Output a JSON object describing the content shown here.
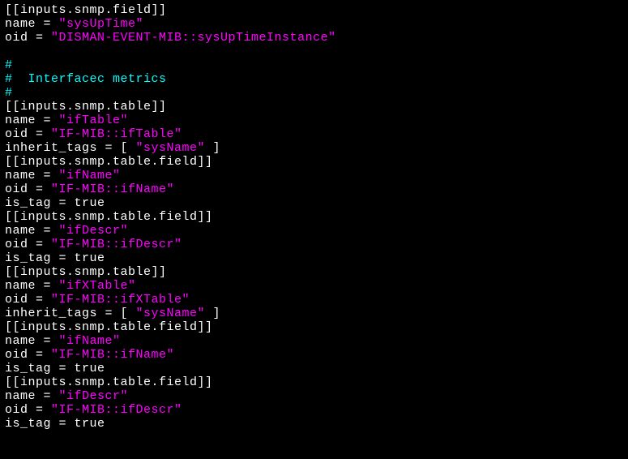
{
  "lines": [
    {
      "segments": [
        {
          "cls": "w",
          "text": "[[inputs.snmp.field]]"
        }
      ]
    },
    {
      "segments": [
        {
          "cls": "w",
          "text": "name = "
        },
        {
          "cls": "m",
          "text": "\"sysUpTime\""
        }
      ]
    },
    {
      "segments": [
        {
          "cls": "w",
          "text": "oid = "
        },
        {
          "cls": "m",
          "text": "\"DISMAN-EVENT-MIB::sysUpTimeInstance\""
        }
      ]
    },
    {
      "segments": [
        {
          "cls": "w",
          "text": ""
        }
      ]
    },
    {
      "segments": [
        {
          "cls": "c",
          "text": "#"
        }
      ]
    },
    {
      "segments": [
        {
          "cls": "c",
          "text": "#  Interfacec metrics"
        }
      ]
    },
    {
      "segments": [
        {
          "cls": "c",
          "text": "#"
        }
      ]
    },
    {
      "segments": [
        {
          "cls": "w",
          "text": "[[inputs.snmp.table]]"
        }
      ]
    },
    {
      "segments": [
        {
          "cls": "w",
          "text": "name = "
        },
        {
          "cls": "m",
          "text": "\"ifTable\""
        }
      ]
    },
    {
      "segments": [
        {
          "cls": "w",
          "text": "oid = "
        },
        {
          "cls": "m",
          "text": "\"IF-MIB::ifTable\""
        }
      ]
    },
    {
      "segments": [
        {
          "cls": "w",
          "text": "inherit_tags = [ "
        },
        {
          "cls": "m",
          "text": "\"sysName\""
        },
        {
          "cls": "w",
          "text": " ]"
        }
      ]
    },
    {
      "segments": [
        {
          "cls": "w",
          "text": "[[inputs.snmp.table.field]]"
        }
      ]
    },
    {
      "segments": [
        {
          "cls": "w",
          "text": "name = "
        },
        {
          "cls": "m",
          "text": "\"ifName\""
        }
      ]
    },
    {
      "segments": [
        {
          "cls": "w",
          "text": "oid = "
        },
        {
          "cls": "m",
          "text": "\"IF-MIB::ifName\""
        }
      ]
    },
    {
      "segments": [
        {
          "cls": "w",
          "text": "is_tag = true"
        }
      ]
    },
    {
      "segments": [
        {
          "cls": "w",
          "text": "[[inputs.snmp.table.field]]"
        }
      ]
    },
    {
      "segments": [
        {
          "cls": "w",
          "text": "name = "
        },
        {
          "cls": "m",
          "text": "\"ifDescr\""
        }
      ]
    },
    {
      "segments": [
        {
          "cls": "w",
          "text": "oid = "
        },
        {
          "cls": "m",
          "text": "\"IF-MIB::ifDescr\""
        }
      ]
    },
    {
      "segments": [
        {
          "cls": "w",
          "text": "is_tag = true"
        }
      ]
    },
    {
      "segments": [
        {
          "cls": "w",
          "text": "[[inputs.snmp.table]]"
        }
      ]
    },
    {
      "segments": [
        {
          "cls": "w",
          "text": "name = "
        },
        {
          "cls": "m",
          "text": "\"ifXTable\""
        }
      ]
    },
    {
      "segments": [
        {
          "cls": "w",
          "text": "oid = "
        },
        {
          "cls": "m",
          "text": "\"IF-MIB::ifXTable\""
        }
      ]
    },
    {
      "segments": [
        {
          "cls": "w",
          "text": "inherit_tags = [ "
        },
        {
          "cls": "m",
          "text": "\"sysName\""
        },
        {
          "cls": "w",
          "text": " ]"
        }
      ]
    },
    {
      "segments": [
        {
          "cls": "w",
          "text": "[[inputs.snmp.table.field]]"
        }
      ]
    },
    {
      "segments": [
        {
          "cls": "w",
          "text": "name = "
        },
        {
          "cls": "m",
          "text": "\"ifName\""
        }
      ]
    },
    {
      "segments": [
        {
          "cls": "w",
          "text": "oid = "
        },
        {
          "cls": "m",
          "text": "\"IF-MIB::ifName\""
        }
      ]
    },
    {
      "segments": [
        {
          "cls": "w",
          "text": "is_tag = true"
        }
      ]
    },
    {
      "segments": [
        {
          "cls": "w",
          "text": "[[inputs.snmp.table.field]]"
        }
      ]
    },
    {
      "segments": [
        {
          "cls": "w",
          "text": "name = "
        },
        {
          "cls": "m",
          "text": "\"ifDescr\""
        }
      ]
    },
    {
      "segments": [
        {
          "cls": "w",
          "text": "oid = "
        },
        {
          "cls": "m",
          "text": "\"IF-MIB::ifDescr\""
        }
      ]
    },
    {
      "segments": [
        {
          "cls": "w",
          "text": "is_tag = true"
        }
      ]
    }
  ]
}
